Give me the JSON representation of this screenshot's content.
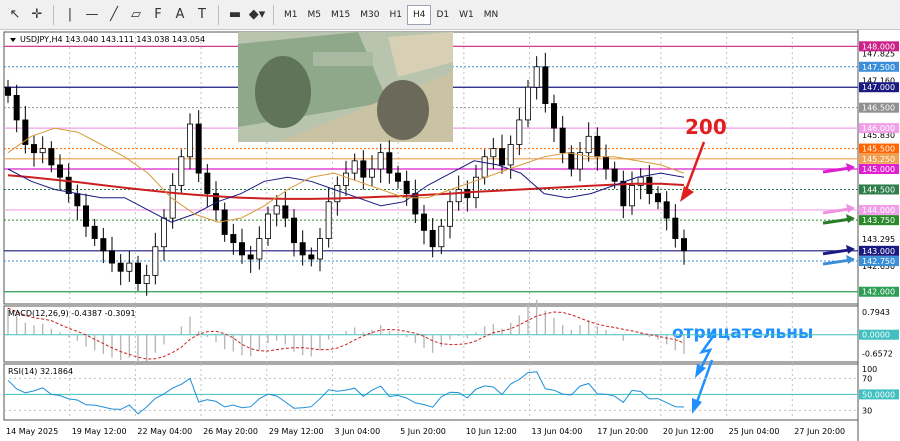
{
  "toolbar": {
    "tools": [
      {
        "name": "cursor-icon",
        "glyph": "↖"
      },
      {
        "name": "crosshair-icon",
        "glyph": "✛"
      },
      {
        "name": "vertical-line-icon",
        "glyph": "|"
      },
      {
        "name": "horizontal-line-icon",
        "glyph": "—"
      },
      {
        "name": "trendline-icon",
        "glyph": "╱"
      },
      {
        "name": "channel-icon",
        "glyph": "▱"
      },
      {
        "name": "fibonacci-icon",
        "glyph": "F"
      },
      {
        "name": "text-icon",
        "glyph": "A"
      },
      {
        "name": "label-icon",
        "glyph": "T"
      },
      {
        "name": "rectangle-icon",
        "glyph": "▬"
      },
      {
        "name": "shapes-icon",
        "glyph": "◆▾"
      }
    ],
    "timeframes": [
      "M1",
      "M5",
      "M15",
      "M30",
      "H1",
      "H4",
      "D1",
      "W1",
      "MN"
    ],
    "active_timeframe": "H4"
  },
  "chart_data": {
    "type": "candlestick",
    "symbol_info": "USDJPY,H4  143.040 143.111 143.038 143.054",
    "main_axis": {
      "range": [
        141.7,
        148.35
      ],
      "tick_labels": [
        {
          "value": 147.825,
          "label": "147.825"
        },
        {
          "value": 147.16,
          "label": "147.160"
        },
        {
          "value": 145.83,
          "label": "145.830"
        },
        {
          "value": 143.295,
          "label": "143.295"
        },
        {
          "value": 142.63,
          "label": "142.630"
        }
      ],
      "level_tags": [
        {
          "value": 148.0,
          "label": "148.000",
          "color": "#cc2288"
        },
        {
          "value": 147.5,
          "label": "147.500",
          "color": "#3a8fd8"
        },
        {
          "value": 147.0,
          "label": "147.000",
          "color": "#1a1a80"
        },
        {
          "value": 146.5,
          "label": "146.500",
          "color": "#909090"
        },
        {
          "value": 146.0,
          "label": "146.000",
          "color": "#f0a0e8"
        },
        {
          "value": 145.5,
          "label": "145.500",
          "color": "#ff6600"
        },
        {
          "value": 145.25,
          "label": "145.250",
          "color": "#f0a050"
        },
        {
          "value": 145.0,
          "label": "145.000",
          "color": "#e020d0"
        },
        {
          "value": 144.5,
          "label": "144.500",
          "color": "#2e7d4a"
        },
        {
          "value": 144.0,
          "label": "144.000",
          "color": "#f0a0e8"
        },
        {
          "value": 143.75,
          "label": "143.750",
          "color": "#2a8a2a"
        },
        {
          "value": 143.0,
          "label": "143.000",
          "color": "#1a1a80"
        },
        {
          "value": 142.75,
          "label": "142.750",
          "color": "#3a8fd8"
        },
        {
          "value": 142.0,
          "label": "142.000",
          "color": "#2e9e55"
        }
      ],
      "horizontal_lines": [
        {
          "value": 148.0,
          "color": "#cc2288",
          "style": "solid"
        },
        {
          "value": 147.5,
          "color": "#3a8fd8",
          "style": "dotted"
        },
        {
          "value": 147.0,
          "color": "#1a1a80",
          "style": "solid"
        },
        {
          "value": 146.5,
          "color": "#909090",
          "style": "dotted"
        },
        {
          "value": 146.0,
          "color": "#f0a0e8",
          "style": "solid"
        },
        {
          "value": 145.5,
          "color": "#ff6600",
          "style": "dotted"
        },
        {
          "value": 145.25,
          "color": "#f0a050",
          "style": "solid"
        },
        {
          "value": 145.0,
          "color": "#e020d0",
          "style": "solid"
        },
        {
          "value": 144.5,
          "color": "#2e7d4a",
          "style": "dotted"
        },
        {
          "value": 144.0,
          "color": "#f0a0e8",
          "style": "solid"
        },
        {
          "value": 143.75,
          "color": "#2a8a2a",
          "style": "dotted"
        },
        {
          "value": 143.0,
          "color": "#1a1a80",
          "style": "solid"
        },
        {
          "value": 142.75,
          "color": "#3a8fd8",
          "style": "dotted"
        },
        {
          "value": 142.0,
          "color": "#2e9e55",
          "style": "solid"
        }
      ],
      "arrows": [
        {
          "value": 145.0,
          "color": "#e020d0"
        },
        {
          "value": 144.0,
          "color": "#f090e0"
        },
        {
          "value": 143.75,
          "color": "#2a7a2a"
        },
        {
          "value": 143.0,
          "color": "#1a1a80"
        },
        {
          "value": 142.75,
          "color": "#3a8fd8"
        }
      ]
    },
    "x_labels": [
      "14 May 2025",
      "19 May 12:00",
      "22 May 04:00",
      "26 May 20:00",
      "29 May 12:00",
      "3 Jun 04:00",
      "5 Jun 20:00",
      "10 Jun 12:00",
      "13 Jun 04:00",
      "17 Jun 20:00",
      "20 Jun 12:00",
      "25 Jun 04:00",
      "27 Jun 20:00"
    ],
    "close_path": [
      146.8,
      146.2,
      145.6,
      145.4,
      145.5,
      145.1,
      144.8,
      144.4,
      144.1,
      143.6,
      143.3,
      143.0,
      142.7,
      142.5,
      142.7,
      142.2,
      142.4,
      143.1,
      143.8,
      144.6,
      145.3,
      146.1,
      144.9,
      144.4,
      144.0,
      143.4,
      143.2,
      142.9,
      142.8,
      143.3,
      143.9,
      144.1,
      143.8,
      143.2,
      142.9,
      142.8,
      143.3,
      144.2,
      144.6,
      144.9,
      145.2,
      144.8,
      145.0,
      145.4,
      144.9,
      144.7,
      144.4,
      143.9,
      143.5,
      143.1,
      143.6,
      144.2,
      144.5,
      144.3,
      144.8,
      145.3,
      145.5,
      145.1,
      145.6,
      146.2,
      147.0,
      147.5,
      146.6,
      146.0,
      145.4,
      145.0,
      145.4,
      145.8,
      145.3,
      145.0,
      144.7,
      144.1,
      144.6,
      144.8,
      144.4,
      144.2,
      143.8,
      143.3,
      143.0
    ],
    "moving_averages": [
      {
        "label": "200",
        "color": "#cc1f1f",
        "width": 2,
        "values": [
          144.85,
          144.8,
          144.74,
          144.68,
          144.61,
          144.54,
          144.48,
          144.42,
          144.37,
          144.33,
          144.3,
          144.28,
          144.27,
          144.27,
          144.28,
          144.3,
          144.32,
          144.34,
          144.37,
          144.4,
          144.44,
          144.47,
          144.5,
          144.53,
          144.56,
          144.59,
          144.62,
          144.64,
          144.64,
          144.61
        ]
      },
      {
        "color": "#1a1a80",
        "width": 1,
        "values": [
          145.0,
          144.7,
          144.5,
          144.4,
          144.3,
          144.3,
          144.0,
          143.7,
          143.9,
          144.2,
          144.4,
          144.7,
          144.8,
          144.7,
          144.5,
          144.3,
          144.1,
          144.2,
          144.6,
          144.9,
          145.2,
          145.1,
          144.9,
          144.4,
          144.3,
          144.4,
          144.6,
          144.8,
          144.9,
          144.8
        ]
      },
      {
        "color": "#d99a3a",
        "width": 1,
        "values": [
          145.4,
          145.8,
          146.0,
          145.9,
          145.6,
          145.3,
          144.9,
          144.3,
          143.9,
          143.7,
          143.8,
          144.1,
          144.5,
          144.8,
          144.9,
          144.7,
          144.5,
          144.3,
          144.3,
          144.5,
          144.7,
          144.9,
          145.1,
          145.3,
          145.4,
          145.3,
          145.3,
          145.2,
          145.1,
          144.9
        ]
      }
    ],
    "image_inset": {
      "description": "Photo of US dollar and Japanese yen banknotes"
    },
    "annotations": [
      {
        "label": "200",
        "color": "#e02020"
      },
      {
        "label": "отрицательны",
        "color": "#1e90ff"
      }
    ],
    "macd": {
      "label": "MACD(12,26,9) -0.4387 -0.3091",
      "range": [
        -0.95,
        1.0
      ],
      "tick_labels": [
        {
          "value": 0.7943,
          "label": "0.7943"
        },
        {
          "value": -0.6572,
          "label": "-0.6572"
        }
      ],
      "zero_tag": {
        "value": 0.0,
        "label": "0.0000",
        "color": "#40c0c0"
      }
    },
    "rsi": {
      "label": "RSI(14) 32.1864",
      "range": [
        18,
        88
      ],
      "tick_labels": [
        {
          "value": 70,
          "label": "70"
        },
        {
          "value": 30,
          "label": "30"
        }
      ],
      "level_tag": {
        "value": 50,
        "label": "50.0000",
        "color": "#40c0c0"
      },
      "tick_100": "100"
    }
  }
}
